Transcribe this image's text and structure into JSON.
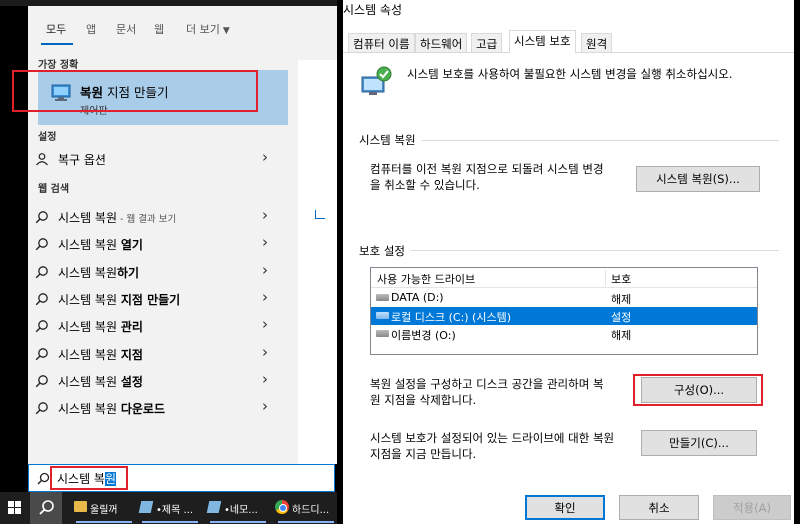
{
  "search": {
    "tabs": [
      "모두",
      "앱",
      "문서",
      "웹",
      "더 보기"
    ],
    "best_match_label": "가장 정확",
    "best_match": {
      "title_bold": "복원",
      "title_rest": " 지점 만들기",
      "subtitle": "제어판"
    },
    "settings_label": "설정",
    "settings_items": [
      {
        "text": "복구 옵션"
      }
    ],
    "web_label": "웹 검색",
    "web_items": [
      {
        "prefix": "시스템 복원",
        "bold": "",
        "suffix": " - 웹 결과 보기"
      },
      {
        "prefix": "시스템 복원 ",
        "bold": "열기",
        "suffix": ""
      },
      {
        "prefix": "시스템 복원",
        "bold": "하기",
        "suffix": ""
      },
      {
        "prefix": "시스템 복원 ",
        "bold": "지점 만들기",
        "suffix": ""
      },
      {
        "prefix": "시스템 복원 ",
        "bold": "관리",
        "suffix": ""
      },
      {
        "prefix": "시스템 복원 ",
        "bold": "지점",
        "suffix": ""
      },
      {
        "prefix": "시스템 복원 ",
        "bold": "설정",
        "suffix": ""
      },
      {
        "prefix": "시스템 복원 ",
        "bold": "다운로드",
        "suffix": ""
      }
    ],
    "query_plain": "시스템 복",
    "query_selected": "원"
  },
  "taskbar": {
    "items": [
      "울릴꺼",
      "•제목 ...",
      "•네모...",
      "하드디..."
    ]
  },
  "dialog": {
    "title": "시스템 속성",
    "tabs": [
      "컴퓨터 이름",
      "하드웨어",
      "고급",
      "시스템 보호",
      "원격"
    ],
    "active_tab": "시스템 보호",
    "description": "시스템 보호를 사용하여 불필요한 시스템 변경을 실행 취소하십시오.",
    "restore_group": "시스템 복원",
    "restore_text": "컴퓨터를 이전 복원 지점으로 되돌려 시스템 변경을 취소할 수 있습니다.",
    "restore_button": "시스템 복원(S)...",
    "protection_group": "보호 설정",
    "table": {
      "col_drive": "사용 가능한 드라이브",
      "col_protection": "보호",
      "rows": [
        {
          "name": "DATA (D:)",
          "protection": "해제",
          "selected": false
        },
        {
          "name": "로컬 디스크 (C:) (시스템)",
          "protection": "설정",
          "selected": true
        },
        {
          "name": "이름변경 (O:)",
          "protection": "해제",
          "selected": false
        }
      ]
    },
    "configure_text": "복원 설정을 구성하고 디스크 공간을 관리하며 복원 지점을 삭제합니다.",
    "configure_button": "구성(O)...",
    "create_text": "시스템 보호가 설정되어 있는 드라이브에 대한 복원 지점을 지금 만듭니다.",
    "create_button": "만들기(C)...",
    "ok_button": "확인",
    "cancel_button": "취소",
    "apply_button": "적용(A)"
  },
  "colors": {
    "accent": "#0078d4",
    "highlight_red": "#e0202a",
    "best_match_bg": "#a9cce8",
    "selected_row": "#0078d7"
  }
}
